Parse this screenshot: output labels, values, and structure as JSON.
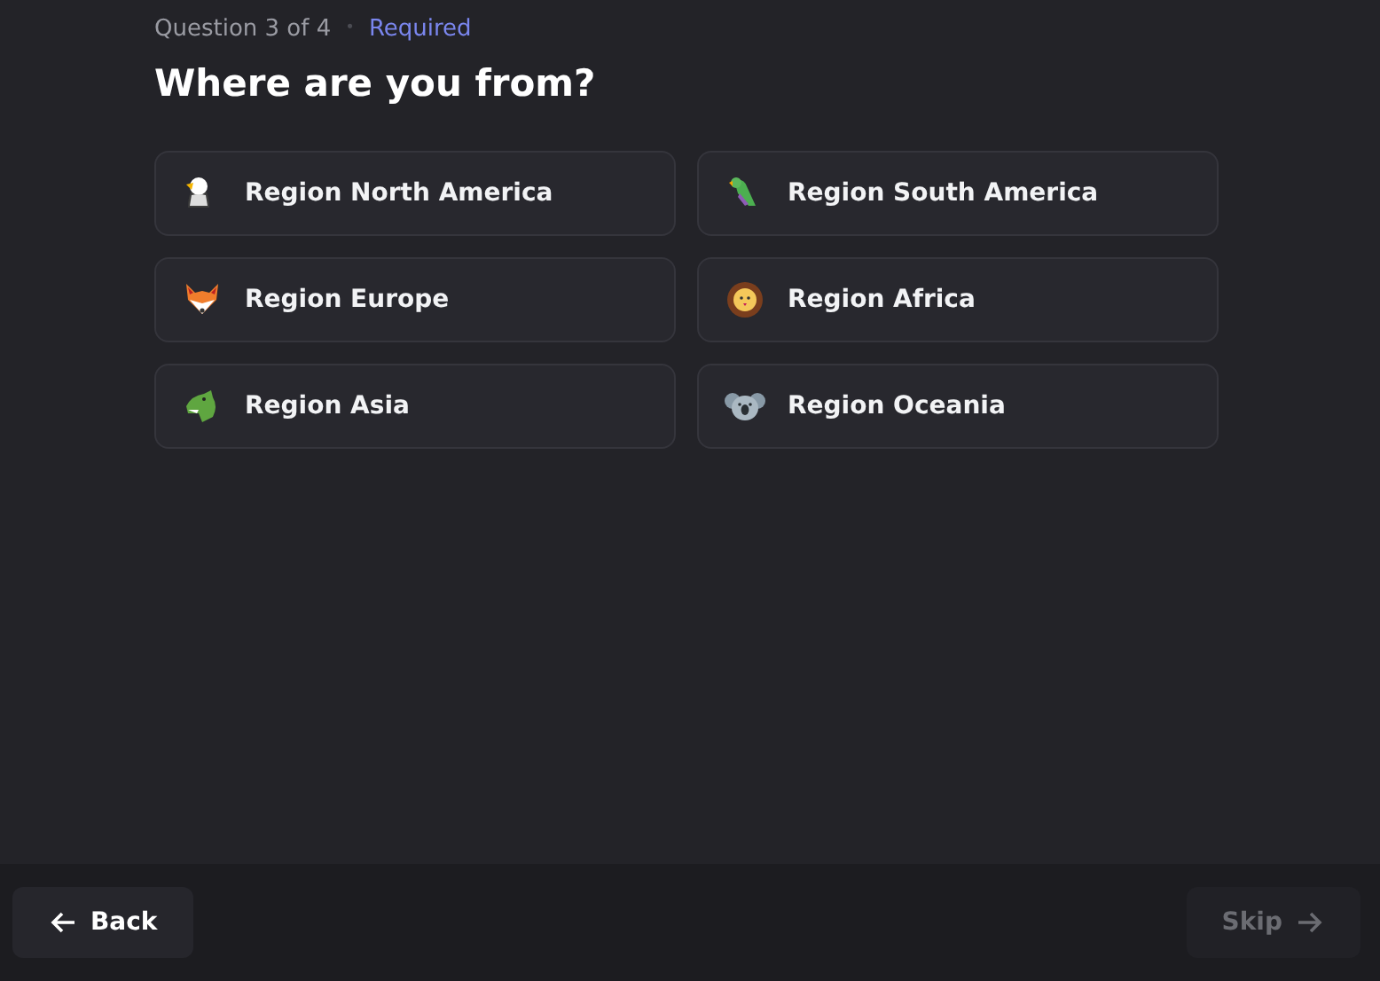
{
  "header": {
    "progress": "Question 3 of 4",
    "separator": "•",
    "required": "Required"
  },
  "question": "Where are you from?",
  "options": [
    {
      "label": "Region North America",
      "selected": false
    },
    {
      "label": "Region South America",
      "selected": false
    },
    {
      "label": "Region Europe",
      "selected": false
    },
    {
      "label": "Region Africa",
      "selected": false
    },
    {
      "label": "Region Asia",
      "selected": false
    },
    {
      "label": "Region Oceania",
      "selected": false
    }
  ],
  "footer": {
    "back": {
      "label": "Back",
      "disabled": false
    },
    "skip": {
      "label": "Skip",
      "disabled": true
    }
  }
}
